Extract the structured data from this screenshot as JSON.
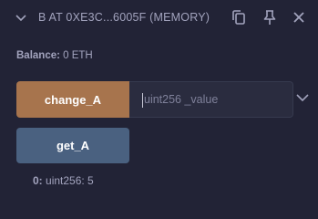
{
  "contract": {
    "title": "B AT 0XE3C...6005F (MEMORY)",
    "balance_label": "Balance:",
    "balance_value": "0 ETH"
  },
  "functions": [
    {
      "name": "change_A",
      "kind": "transact",
      "color": "#a7744d",
      "input_placeholder": "uint256 _value",
      "input_value": ""
    },
    {
      "name": "get_A",
      "kind": "call",
      "color": "#4a6180"
    }
  ],
  "result": {
    "index": "0:",
    "value": "uint256: 5"
  },
  "icons": {
    "collapse": "chevron-down-icon",
    "copy": "copy-icon",
    "pin": "pin-icon",
    "close": "close-icon",
    "expand": "chevron-down-icon"
  }
}
